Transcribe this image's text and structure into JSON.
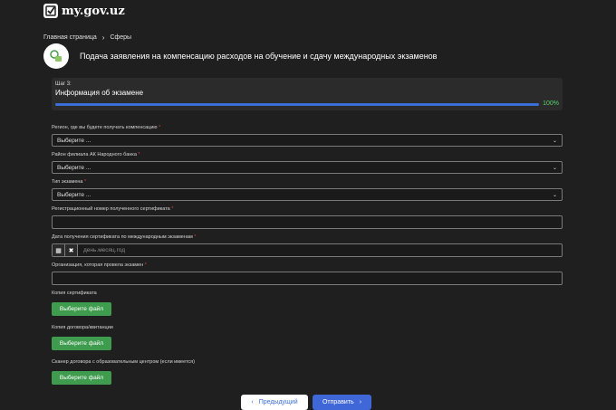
{
  "site": {
    "logo_text": "my.gov.uz"
  },
  "breadcrumb": {
    "home": "Главная страница",
    "separator": "›",
    "current": "Сферы"
  },
  "page_title": "Подача заявления на компенсацию расходов на обучение и сдачу международных экзаменов",
  "step": {
    "label": "Шаг 3:",
    "title": "Информация об экзамене",
    "progress": 100,
    "progress_label": "100%"
  },
  "fields": {
    "region": {
      "label": "Регион, где вы будете получать компенсацию",
      "required": "*",
      "value": "Выберите ..."
    },
    "bank_branch": {
      "label": "Район филиала АК Народного банка",
      "required": "*",
      "value": "Выберите ..."
    },
    "exam_type": {
      "label": "Тип экзамена",
      "required": "*",
      "value": "Выберите ..."
    },
    "cert_number": {
      "label": "Регистрационный номер полученного сертификата",
      "required": "*",
      "value": ""
    },
    "cert_date": {
      "label": "Дата получения сертификата по международным экзаменам",
      "required": "*",
      "placeholder": "день.месяц.год"
    },
    "organization": {
      "label": "Организация, которая провела экзамен",
      "required": "*",
      "value": ""
    }
  },
  "uploads": {
    "certificate": {
      "label": "Копия сертификата",
      "button": "Выберите файл"
    },
    "contract": {
      "label": "Копия договора/квитанции",
      "button": "Выберите файл"
    },
    "scan": {
      "label": "Сканер договора с образовательным центром (если имеется)",
      "button": "Выберите файл"
    }
  },
  "nav": {
    "prev": "Предыдущий",
    "next": "Отправить"
  },
  "colors": {
    "accent": "#3f67d8",
    "success": "#3f9c4f",
    "progress_text": "#5ad06a",
    "background": "#1f1f1f"
  },
  "icons": {
    "logo": "checkmark-icon",
    "header": "education-icon",
    "calendar": "calendar-icon",
    "clear": "close-icon",
    "dropdown": "chevron-down-icon",
    "prev": "chevron-left-icon",
    "next": "chevron-right-icon"
  }
}
